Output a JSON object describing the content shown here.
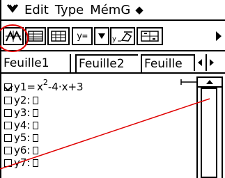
{
  "menubar": {
    "menu_icon": "chevron-down-icon",
    "items": [
      "Edit",
      "Type",
      "MémG"
    ],
    "more": "◆"
  },
  "toolbar": {
    "buttons": [
      {
        "name": "graph-draw-icon",
        "label": ""
      },
      {
        "name": "table-icon",
        "label": ""
      },
      {
        "name": "table-view-icon",
        "label": ""
      },
      {
        "name": "function-type-button",
        "label": "y="
      },
      {
        "name": "dropdown-button",
        "label": ""
      },
      {
        "name": "graph-style-button",
        "label": ""
      },
      {
        "name": "dynamic-graph-button",
        "label": ""
      }
    ],
    "more_icon": "triangle-right-icon"
  },
  "tabs": {
    "items": [
      "Feuille1",
      "Feuille2",
      "Feuille"
    ],
    "active": "Feuille1"
  },
  "functions": [
    {
      "label": "y1=",
      "checked": true,
      "expr_a": "x",
      "expr_exp": "2",
      "expr_b": "-4·x+3"
    },
    {
      "label": "y2:",
      "checked": false
    },
    {
      "label": "y3:",
      "checked": false
    },
    {
      "label": "y4:",
      "checked": false
    },
    {
      "label": "y5:",
      "checked": false
    },
    {
      "label": "y6:",
      "checked": false
    },
    {
      "label": "y7:",
      "checked": false
    }
  ],
  "annotation_color": "#e00000"
}
